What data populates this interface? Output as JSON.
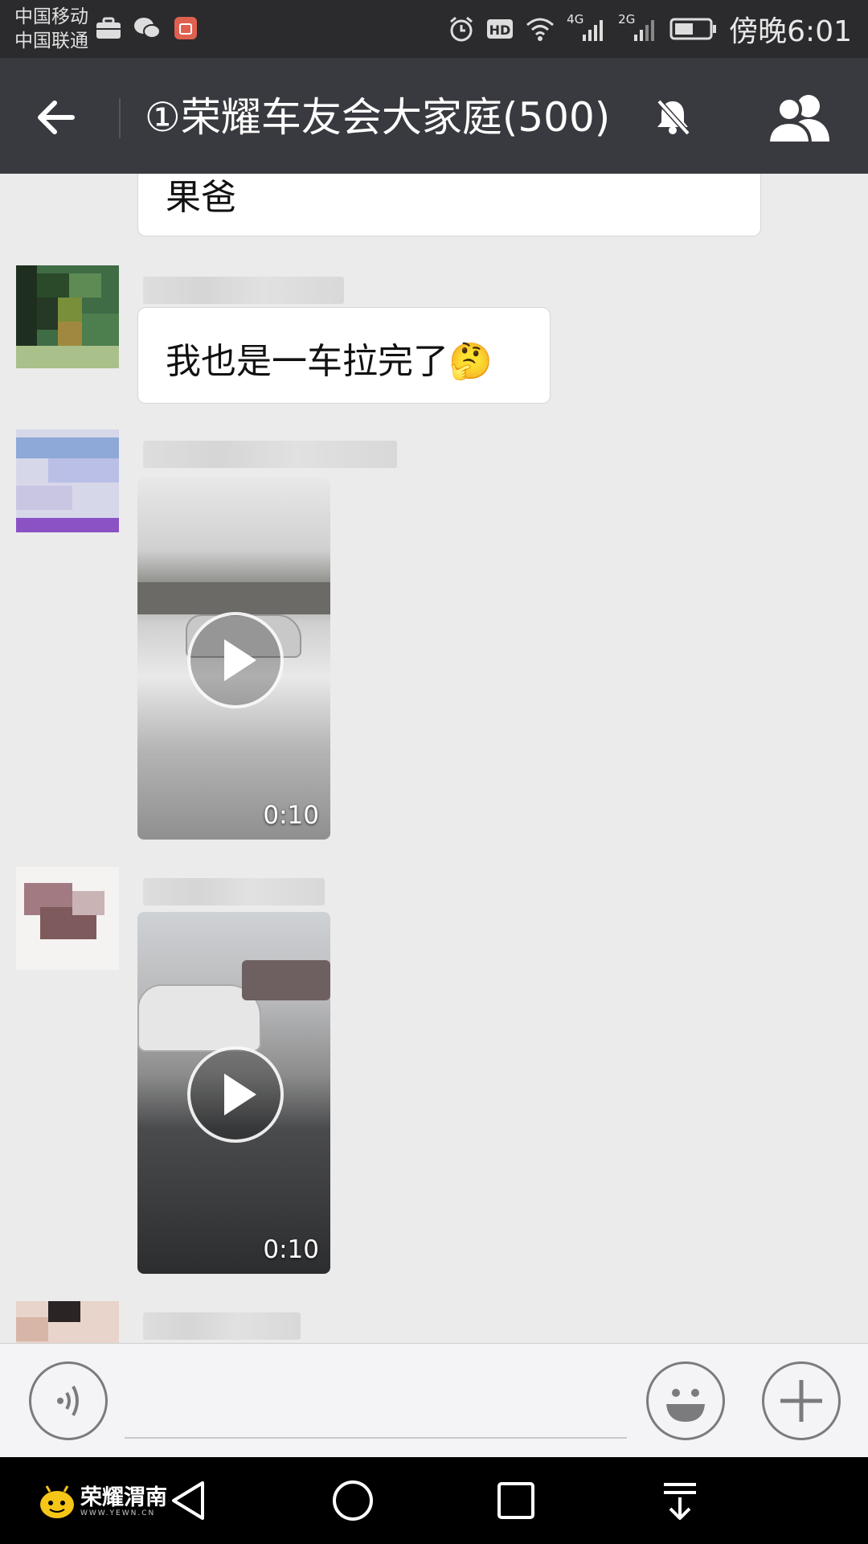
{
  "status_bar": {
    "carrier_1": "中国移动",
    "carrier_2": "中国联通",
    "network_1": "4G",
    "network_2": "2G",
    "time": "傍晚6:01",
    "icons": [
      "briefcase-icon",
      "wechat-icon",
      "notification-app-icon",
      "alarm-icon",
      "hd-icon",
      "wifi-icon",
      "signal-icon",
      "battery-icon"
    ]
  },
  "header": {
    "title": "①荣耀车友会大家庭(500)",
    "icons": [
      "back-arrow-icon",
      "mute-bell-icon",
      "group-members-icon"
    ]
  },
  "messages": [
    {
      "type": "text",
      "text": "果爸"
    },
    {
      "type": "text",
      "text": "我也是一车拉完了🤔"
    },
    {
      "type": "video",
      "duration": "0:10"
    },
    {
      "type": "video",
      "duration": "0:10"
    }
  ],
  "input_bar": {
    "icons": [
      "voice-icon",
      "emoji-icon",
      "plus-icon"
    ]
  },
  "nav_bar": {
    "watermark": "荣耀渭南",
    "watermark_url": "WWW.YEWN.CN",
    "icons": [
      "back-triangle-icon",
      "home-circle-icon",
      "recents-square-icon",
      "notification-pulldown-icon"
    ]
  },
  "colors": {
    "title_bar": "#393a3f",
    "status_bar": "#2b2b2e",
    "chat_bg": "#ebebeb",
    "nav_bar": "#000000"
  }
}
